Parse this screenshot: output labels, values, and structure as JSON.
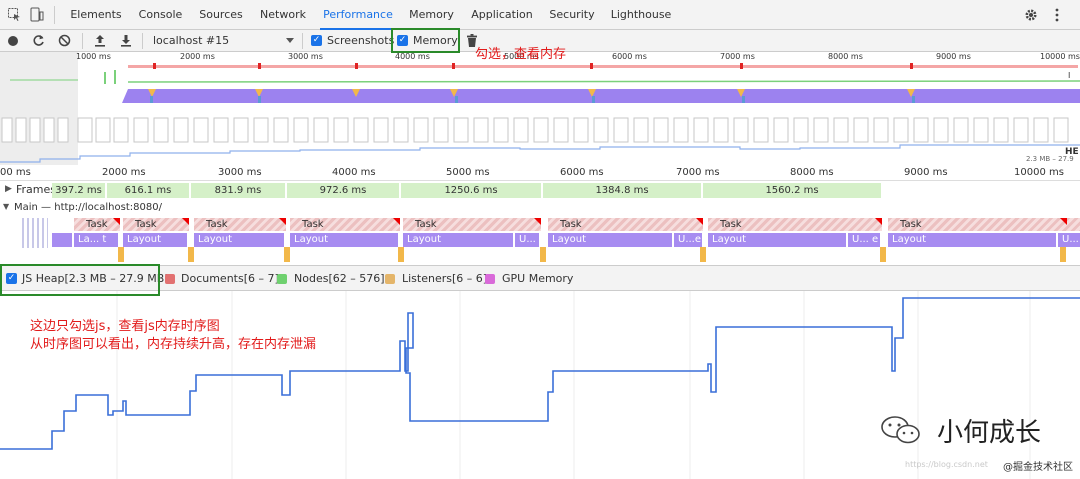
{
  "tabs": [
    "Elements",
    "Console",
    "Sources",
    "Network",
    "Performance",
    "Memory",
    "Application",
    "Security",
    "Lighthouse"
  ],
  "toolbar": {
    "profile_select": "localhost #15",
    "screenshots_label": "Screenshots",
    "memory_label": "Memory"
  },
  "overview_ticks": [
    "1000 ms",
    "2000 ms",
    "3000 ms",
    "4000 ms",
    "5000 ms",
    "6000 ms",
    "7000 ms",
    "8000 ms",
    "9000 ms",
    "10000 ms"
  ],
  "overview_labels": {
    "heap_range": "2.3 MB – 27.9",
    "heap_tag": "HE"
  },
  "main_ticks": [
    "00 ms",
    "2000 ms",
    "3000 ms",
    "4000 ms",
    "5000 ms",
    "6000 ms",
    "7000 ms",
    "8000 ms",
    "9000 ms",
    "10000 ms"
  ],
  "frames": {
    "label": "Frames",
    "values": [
      "397.2 ms",
      "616.1 ms",
      "831.9 ms",
      "972.6 ms",
      "1250.6 ms",
      "1384.8 ms",
      "1560.2 ms"
    ]
  },
  "main_thread": {
    "title": "Main — http://localhost:8080/",
    "task_label": "Task",
    "layout_label": "Layout",
    "layout_short": "La... t",
    "ellipsis_u": "U... e",
    "ellipsis_u2": "U...",
    "ellipsis_u3": "U...e"
  },
  "counters": [
    {
      "label": "JS Heap[2.3 MB – 27.9 MB]",
      "color": "#3a6fd8",
      "checked": true
    },
    {
      "label": "Documents[6 – 7]",
      "color": "#e27171",
      "checked": false
    },
    {
      "label": "Nodes[62 – 576]",
      "color": "#6fd16f",
      "checked": false
    },
    {
      "label": "Listeners[6 – 6]",
      "color": "#e4b56a",
      "checked": false
    },
    {
      "label": "GPU Memory",
      "color": "#d96ad9",
      "checked": false
    }
  ],
  "annotations": {
    "check_memory": "勾选，查看内存",
    "line1": "这边只勾选js，查看js内存时序图",
    "line2": "从时序图可以看出，内存持续升高，存在内存泄漏"
  },
  "watermark": {
    "brand": "小何成长",
    "site": "@掘金技术社区",
    "faint": "https://blog.csdn.net"
  },
  "colors": {
    "accent": "#1a73e8",
    "heap_line": "#3a6fd8",
    "annotation": "#e21a1a",
    "highlight_box": "#2a8a2a"
  }
}
